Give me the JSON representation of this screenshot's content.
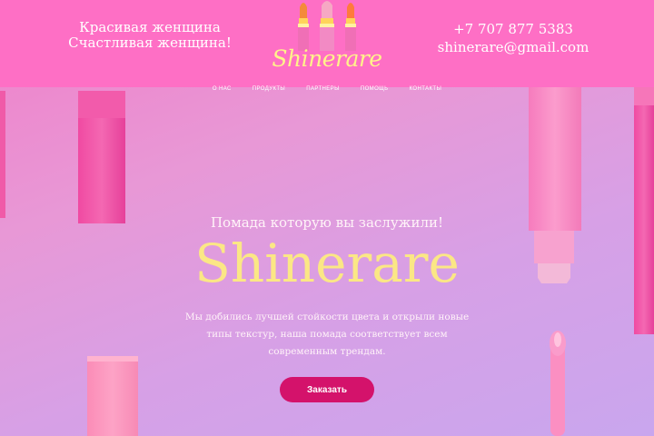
{
  "header": {
    "tagline_line1": "Красивая женщина",
    "tagline_line2": "Счастливая женщина!",
    "logo_text": "Shinerare",
    "phone": "+7 707 877 5383",
    "email": "shinerare@gmail.com"
  },
  "nav": {
    "items": [
      {
        "label": "О НАС"
      },
      {
        "label": "ПРОДУКТЫ"
      },
      {
        "label": "ПАРТНЕРЫ"
      },
      {
        "label": "ПОМОЩЬ"
      },
      {
        "label": "КОНТАКТЫ"
      }
    ]
  },
  "hero": {
    "subtitle": "Помада которую вы заслужили!",
    "brand": "Shinerare",
    "description": "Мы добились лучшей стойкости цвета и открыли новые типы текстур, наша помада соответствует всем современным трендам.",
    "cta_label": "Заказать"
  },
  "colors": {
    "header_bg": "#fe6fc5",
    "brand_yellow": "#fbe785",
    "cta_bg": "#d4126b"
  }
}
